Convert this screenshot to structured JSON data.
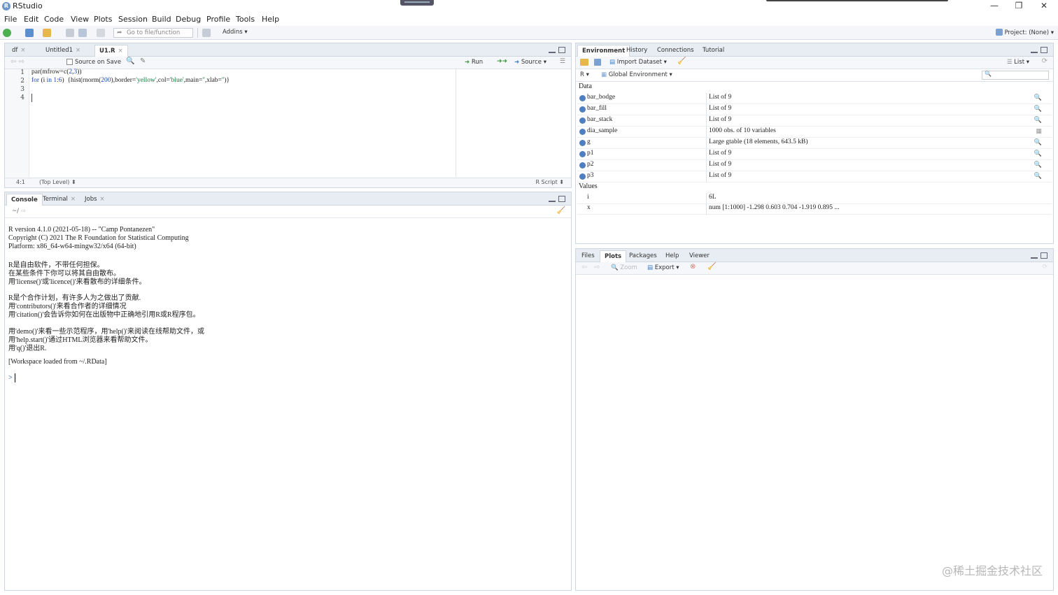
{
  "window": {
    "title": "RStudio",
    "controls": [
      "—",
      "❐",
      "✕"
    ]
  },
  "menu": [
    "File",
    "Edit",
    "Code",
    "View",
    "Plots",
    "Session",
    "Build",
    "Debug",
    "Profile",
    "Tools",
    "Help"
  ],
  "toolbar": {
    "goto_placeholder": "Go to file/function",
    "addins": "Addins ▾",
    "project": "Project: (None) ▾"
  },
  "editor": {
    "tabs": [
      {
        "label": "df"
      },
      {
        "label": "Untitled1"
      },
      {
        "label": "U1.R"
      }
    ],
    "source_on_save": "Source on Save",
    "run": "Run",
    "source": "Source",
    "line_numbers": [
      "1",
      "2",
      "3",
      "4"
    ],
    "status_pos": "4:1",
    "status_scope": "(Top Level) ⬍",
    "status_type": "R Script ⬍"
  },
  "console": {
    "tabs": [
      "Console",
      "Terminal",
      "Jobs"
    ],
    "path": "~/",
    "lines": [
      "R version 4.1.0 (2021-05-18) -- \"Camp Pontanezen\"",
      "Copyright (C) 2021 The R Foundation for Statistical Computing",
      "Platform: x86_64-w64-mingw32/x64 (64-bit)",
      "",
      "R是自由软件，不带任何担保。",
      "在某些条件下你可以将其自由散布。",
      "用'license()'或'licence()'来看散布的详细条件。",
      "",
      "R是个合作计划，有许多人为之做出了贡献.",
      "用'contributors()'来看合作者的详细情况",
      "用'citation()'会告诉你如何在出版物中正确地引用R或R程序包。",
      "",
      "用'demo()'来看一些示范程序，用'help()'来阅读在线帮助文件，或",
      "用'help.start()'通过HTML浏览器来看帮助文件。",
      "用'q()'退出R.",
      "",
      "[Workspace loaded from ~/.RData]"
    ],
    "prompt": ">"
  },
  "environment": {
    "tabs": [
      "Environment",
      "History",
      "Connections",
      "Tutorial"
    ],
    "import_dataset": "Import Dataset ▾",
    "list_label": "List ▾",
    "r_label": "R ▾",
    "global_env": "Global Environment ▾",
    "data_section": "Data",
    "values_section": "Values",
    "data": [
      {
        "name": "bar_bodge",
        "value": "List of 9"
      },
      {
        "name": "bar_fill",
        "value": "List of 9"
      },
      {
        "name": "bar_stack",
        "value": "List of 9"
      },
      {
        "name": "dia_sample",
        "value": "1000 obs. of 10 variables"
      },
      {
        "name": "g",
        "value": "Large gtable (18 elements,  643.5 kB)"
      },
      {
        "name": "p1",
        "value": "List of 9"
      },
      {
        "name": "p2",
        "value": "List of 9"
      },
      {
        "name": "p3",
        "value": "List of 9"
      }
    ],
    "values": [
      {
        "name": "i",
        "value": "6L"
      },
      {
        "name": "x",
        "value": "num [1:1000] -1.298 0.603 0.704 -1.919 0.895 ..."
      }
    ]
  },
  "files": {
    "tabs": [
      "Files",
      "Plots",
      "Packages",
      "Help",
      "Viewer"
    ],
    "zoom": "Zoom",
    "export": "Export ▾"
  },
  "watermark": "@稀土掘金技术社区"
}
